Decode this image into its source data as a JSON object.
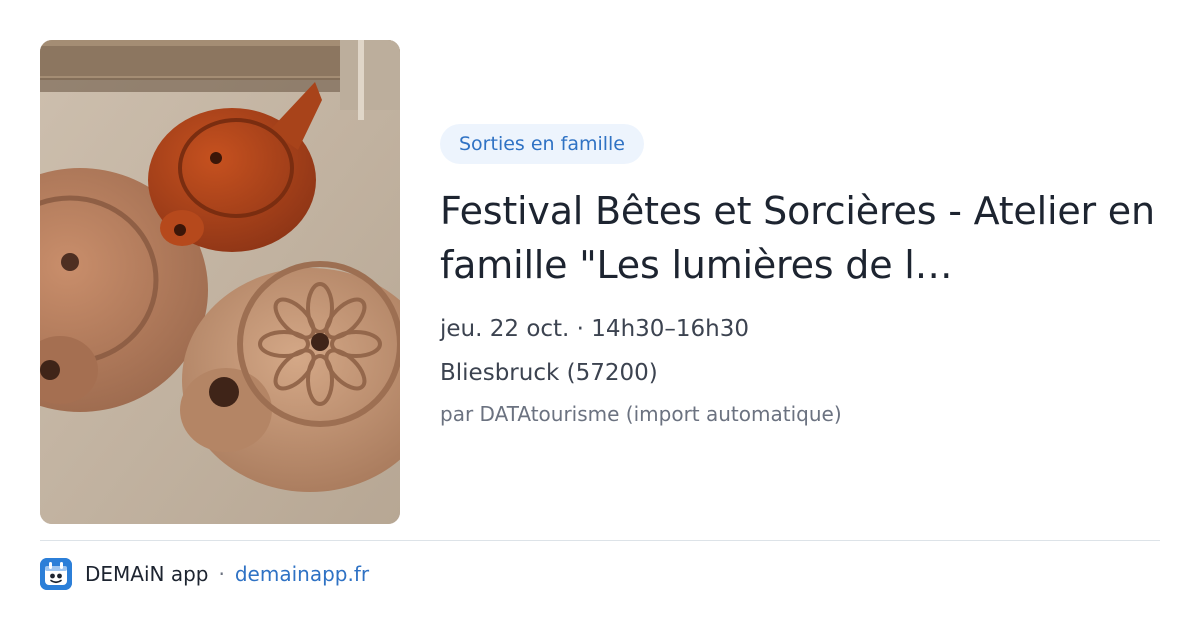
{
  "card": {
    "category_badge": "Sorties en famille",
    "title": "Festival Bêtes et Sorcières - Atelier en famille \"Les lumières de l…",
    "date_time": "jeu. 22 oct. · 14h30–16h30",
    "location": "Bliesbruck (57200)",
    "source": "par DATAtourisme (import automatique)",
    "image_icon": "clay-oil-lamps-photo"
  },
  "footer": {
    "app_name": "DEMAiN app",
    "separator": "·",
    "link": "demainapp.fr",
    "logo_icon": "demain-app-logo-icon"
  },
  "colors": {
    "accent": "#2f72c4",
    "badge_bg": "#edf4fd",
    "title": "#1d2430",
    "meta": "#3c4350",
    "muted": "#6b7280",
    "divider": "#dde3e8"
  }
}
